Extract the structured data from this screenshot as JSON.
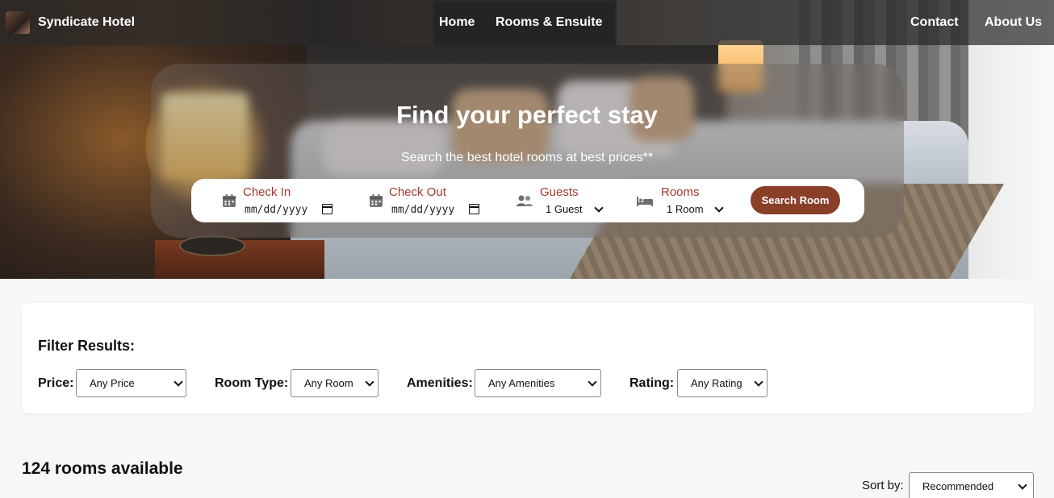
{
  "nav": {
    "brand": "Syndicate Hotel",
    "links": [
      "Home",
      "Rooms & Ensuite",
      "Contact",
      "About Us"
    ]
  },
  "hero": {
    "title": "Find your perfect stay",
    "subtitle": "Search the best hotel rooms at best prices**"
  },
  "search": {
    "check_in": {
      "label": "Check In",
      "value": "mm/dd/yyyy",
      "icon": "calendar-icon"
    },
    "check_out": {
      "label": "Check Out",
      "value": "mm/dd/yyyy",
      "icon": "calendar-icon"
    },
    "guests": {
      "label": "Guests",
      "value": "1 Guest",
      "icon": "users-icon"
    },
    "rooms": {
      "label": "Rooms",
      "value": "1 Room",
      "icon": "bed-icon"
    },
    "button": "Search Room"
  },
  "filters": {
    "title": "Filter Results:",
    "price": {
      "label": "Price:",
      "value": "Any Price"
    },
    "room_type": {
      "label": "Room Type:",
      "value": "Any Room"
    },
    "amenities": {
      "label": "Amenities:",
      "value": "Any Amenities"
    },
    "rating": {
      "label": "Rating:",
      "value": "Any Rating"
    }
  },
  "results": {
    "count_text": "124 rooms available",
    "sort_label": "Sort by:",
    "sort_value": "Recommended"
  },
  "colors": {
    "accent": "#8a3f28",
    "label": "#a33a2a"
  }
}
